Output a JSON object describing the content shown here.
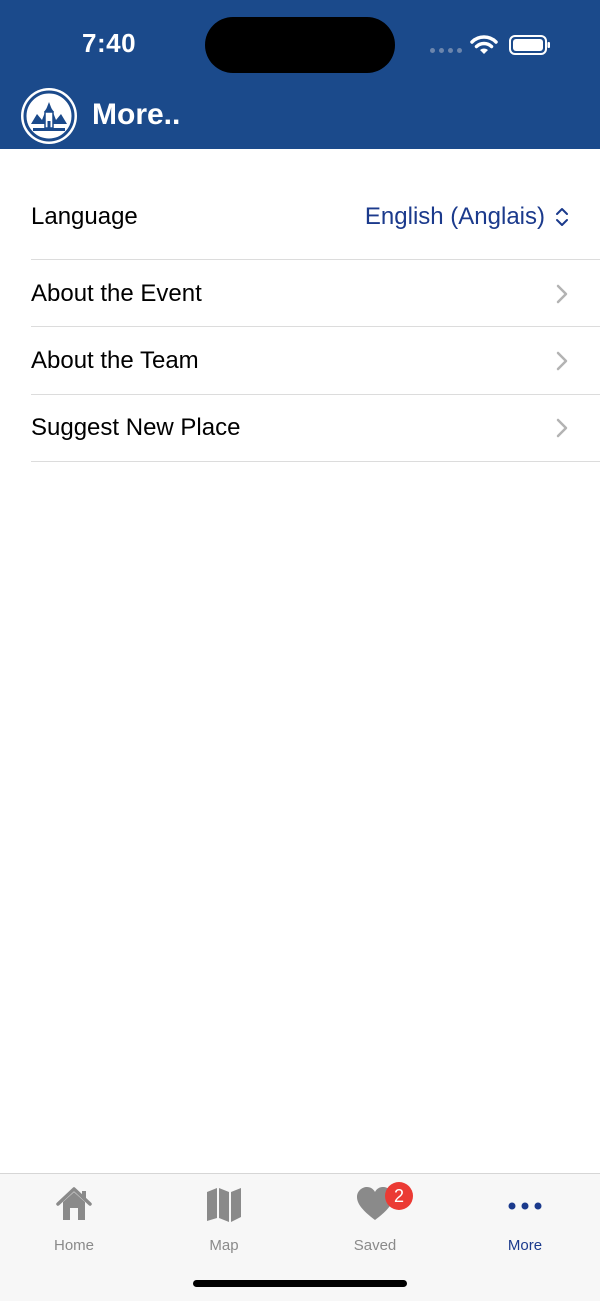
{
  "status_bar": {
    "time": "7:40"
  },
  "header": {
    "title": "More..",
    "logo_icon": "app-logo-icon"
  },
  "settings": {
    "language": {
      "label": "Language",
      "value": "English (Anglais)"
    },
    "items": [
      {
        "label": "About the Event"
      },
      {
        "label": "About the Team"
      },
      {
        "label": "Suggest New Place"
      }
    ]
  },
  "tabbar": {
    "tabs": [
      {
        "label": "Home",
        "icon": "home-icon"
      },
      {
        "label": "Map",
        "icon": "map-icon"
      },
      {
        "label": "Saved",
        "icon": "heart-icon",
        "badge": "2"
      },
      {
        "label": "More",
        "icon": "more-icon"
      }
    ]
  },
  "colors": {
    "header_bg": "#1b4a8b",
    "accent": "#1b3a8c",
    "badge": "#eb3a34",
    "inactive": "#8a8a8a"
  }
}
